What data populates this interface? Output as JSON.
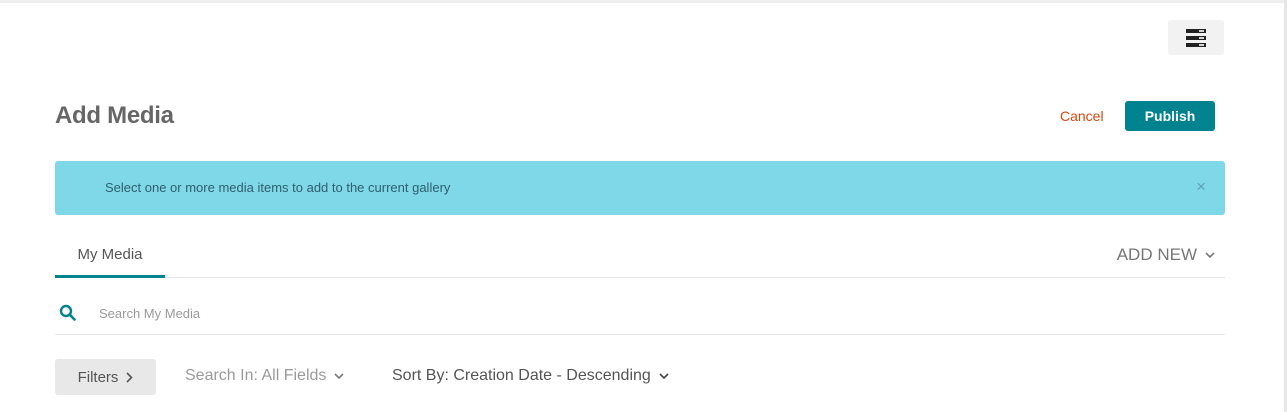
{
  "header": {
    "menu_icon": "list-menu-icon"
  },
  "page": {
    "title": "Add Media",
    "cancel_label": "Cancel",
    "publish_label": "Publish"
  },
  "alert": {
    "message": "Select one or more media items to add to the current gallery",
    "close_symbol": "×"
  },
  "tabs": [
    {
      "label": "My Media",
      "active": true
    }
  ],
  "add_new_label": "ADD NEW",
  "search": {
    "placeholder": "Search My Media",
    "value": ""
  },
  "toolbar": {
    "filters_label": "Filters",
    "search_in_label": "Search In: All Fields",
    "sort_by_label": "Sort By: Creation Date - Descending"
  },
  "colors": {
    "accent": "#00828f",
    "cancel": "#d9480f",
    "alert_bg": "#7fd8e8"
  }
}
